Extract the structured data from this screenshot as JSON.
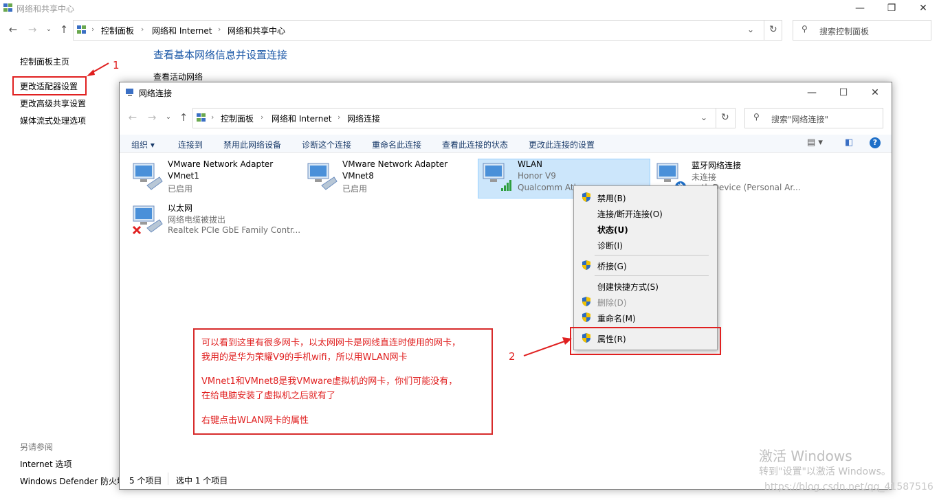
{
  "outer": {
    "title": "网络和共享中心",
    "breadcrumb": [
      "控制面板",
      "网络和 Internet",
      "网络和共享中心"
    ],
    "search_placeholder": "搜索控制面板",
    "sidebar": {
      "links": [
        "控制面板主页",
        "更改适配器设置",
        "更改高级共享设置",
        "媒体流式处理选项"
      ],
      "see_also_title": "另请参阅",
      "see_also": [
        "Internet 选项",
        "Windows Defender 防火墙"
      ]
    },
    "main_heading": "查看基本网络信息并设置连接",
    "active_networks_label": "查看活动网络"
  },
  "inner": {
    "title": "网络连接",
    "breadcrumb": [
      "控制面板",
      "网络和 Internet",
      "网络连接"
    ],
    "search_placeholder": "搜索\"网络连接\"",
    "toolbar": {
      "organize": "组织",
      "items": [
        "连接到",
        "禁用此网络设备",
        "诊断这个连接",
        "重命名此连接",
        "查看此连接的状态",
        "更改此连接的设置"
      ]
    },
    "adapters": [
      {
        "name": "VMware Network Adapter",
        "line2": "VMnet1",
        "line3": "已启用"
      },
      {
        "name": "VMware Network Adapter",
        "line2": "VMnet8",
        "line3": "已启用"
      },
      {
        "name": "WLAN",
        "line2": "Honor V9",
        "line3": "Qualcomm Ath"
      },
      {
        "name": "蓝牙网络连接",
        "line2": "未连接",
        "line3": "ooth Device (Personal Ar..."
      },
      {
        "name": "以太网",
        "line2": "网络电缆被拔出",
        "line3": "Realtek PCIe GbE Family Contr..."
      }
    ],
    "status": {
      "count": "5 个项目",
      "selected": "选中 1 个项目"
    }
  },
  "context_menu": {
    "items": [
      "禁用(B)",
      "连接/断开连接(O)",
      "状态(U)",
      "诊断(I)",
      "桥接(G)",
      "创建快捷方式(S)",
      "删除(D)",
      "重命名(M)",
      "属性(R)"
    ]
  },
  "annotations": {
    "label1": "1",
    "label2": "2",
    "note_lines": [
      "可以看到这里有很多网卡，以太网网卡是网线直连时使用的网卡，",
      "我用的是华为荣耀V9的手机wifi，所以用WLAN网卡",
      "VMnet1和VMnet8是我VMware虚拟机的网卡，你们可能没有，",
      "在给电脑安装了虚拟机之后就有了",
      "右键点击WLAN网卡的属性"
    ]
  },
  "watermark": {
    "line1": "激活 Windows",
    "line2": "转到\"设置\"以激活 Windows。",
    "line3": "https://blog.csdn.net/qq_41587516"
  },
  "colors": {
    "accent": "#1e5aa8",
    "annotation_red": "#e02020",
    "selection": "#cce6fb"
  }
}
